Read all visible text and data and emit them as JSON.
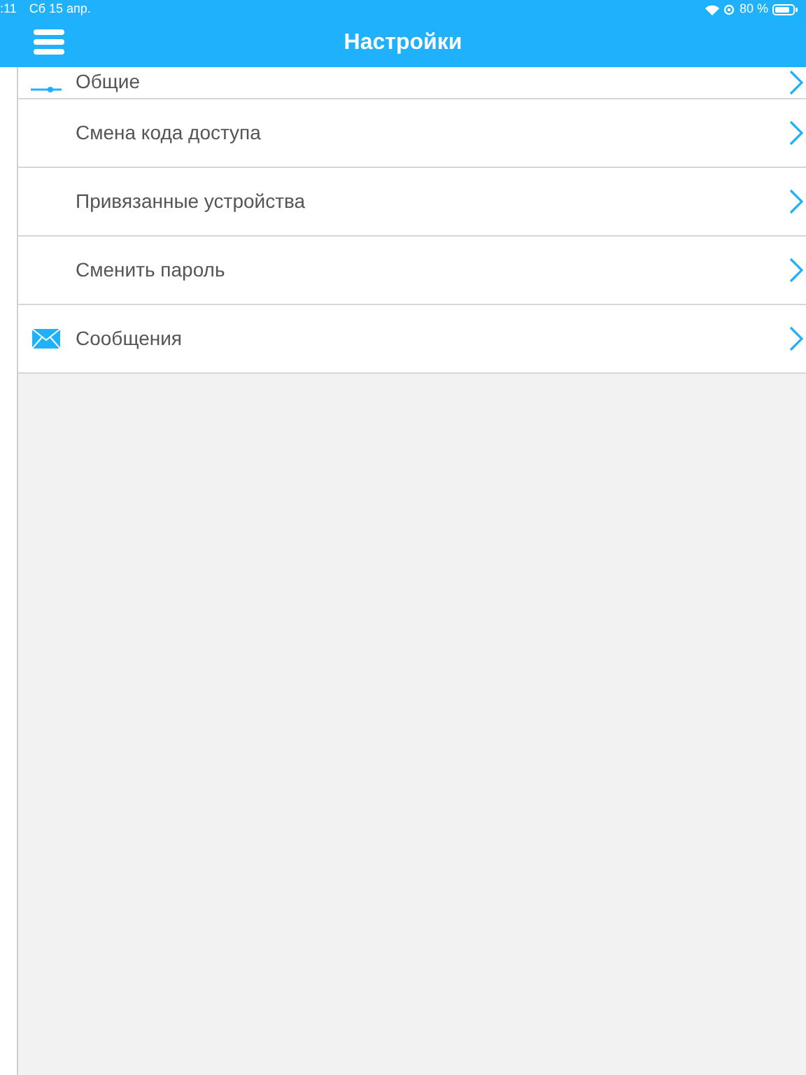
{
  "status_bar": {
    "time": ":11",
    "date": "Сб 15 апр.",
    "battery": "80 %"
  },
  "header": {
    "title": "Настройки"
  },
  "items": [
    {
      "label": "Общие",
      "kind": "sliders"
    },
    {
      "label": "Смена кода доступа",
      "kind": "plain"
    },
    {
      "label": "Привязанные устройства",
      "kind": "plain"
    },
    {
      "label": "Сменить пароль",
      "kind": "plain"
    },
    {
      "label": "Сообщения",
      "kind": "mail"
    }
  ]
}
